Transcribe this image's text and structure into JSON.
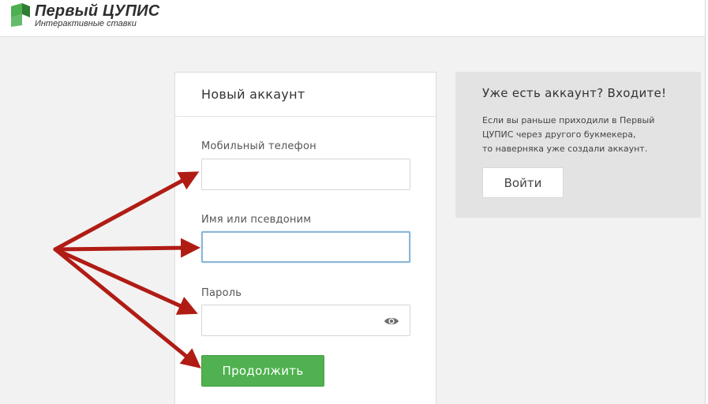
{
  "header": {
    "brand_title": "Первый ЦУПИС",
    "brand_subtitle": "Интерактивные ставки"
  },
  "registration": {
    "title": "Новый аккаунт",
    "phone": {
      "label": "Мобильный телефон",
      "value": ""
    },
    "nickname": {
      "label": "Имя или псевдоним",
      "value": ""
    },
    "password": {
      "label": "Пароль",
      "value": ""
    },
    "continue_label": "Продолжить"
  },
  "login": {
    "title": "Уже есть аккаунт? Входите!",
    "description_lines": [
      "Если вы раньше приходили в Первый",
      "ЦУПИС через другого букмекера,",
      "то наверняка уже создали аккаунт."
    ],
    "button_label": "Войти"
  },
  "colors": {
    "brand_green": "#4fb14f",
    "logo_green_light": "#4caf50",
    "logo_green_dark": "#2e7d32",
    "annotation_arrow": "#b01c14",
    "page_background": "#f2f2f2",
    "focus_border": "#8ab6d6"
  },
  "icons": {
    "logo": "cube-logo-icon",
    "password_toggle": "eye-icon"
  }
}
